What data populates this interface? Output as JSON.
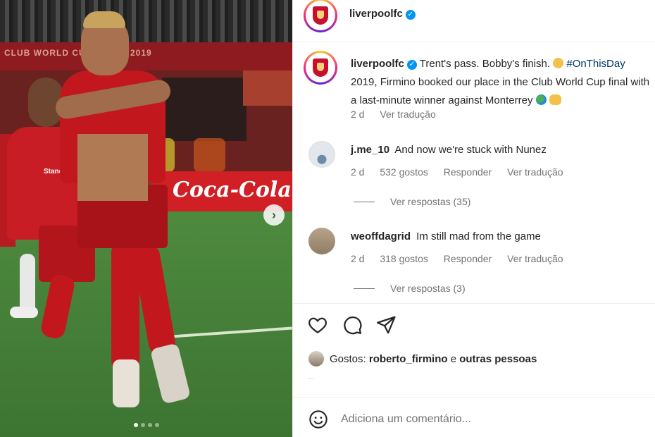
{
  "post": {
    "carousel": {
      "total_slides": 4,
      "active_index": 0
    }
  },
  "header": {
    "username": "liverpoolfc"
  },
  "caption": {
    "username": "liverpoolfc",
    "line1_text": "Trent's pass. Bobby's finish. ",
    "hashtag": "#OnThisDay",
    "line2_text": "2019, Firmino booked our place in the Club World Cup final with",
    "line3_text": "a last-minute winner against Monterrey ",
    "age": "2 d",
    "translate": "Ver tradução"
  },
  "comments": [
    {
      "username": "j.me_10",
      "text": "And now we're stuck with Nunez",
      "age": "2 d",
      "likes": "532 gostos",
      "reply": "Responder",
      "translate": "Ver tradução",
      "view_replies": "Ver respostas (35)"
    },
    {
      "username": "weoffdagrid",
      "text": "Im still mad from the game",
      "age": "2 d",
      "likes": "318 gostos",
      "reply": "Responder",
      "translate": "Ver tradução",
      "view_replies": "Ver respostas (3)"
    }
  ],
  "likes_line": {
    "prefix": "Gostos:",
    "user": "roberto_firmino",
    "suffix": "e",
    "others": "outras pessoas",
    "truncated_date": "..."
  },
  "comment_box": {
    "placeholder": "Adiciona um comentário..."
  },
  "photo_text": {
    "stand": "CLUB WORLD CUP QATAR 2019",
    "board": "Coca-Cola",
    "sponsor": "Standard Chartered"
  },
  "icons": {
    "heart": "heart-icon",
    "comment": "comment-icon",
    "share": "share-icon",
    "emoji": "emoji-icon",
    "next": "chevron-right-icon",
    "verified": "verified-badge-icon"
  },
  "colors": {
    "verified": "#0095f6",
    "hashtag": "#00376b",
    "kit_red": "#c3171e"
  }
}
